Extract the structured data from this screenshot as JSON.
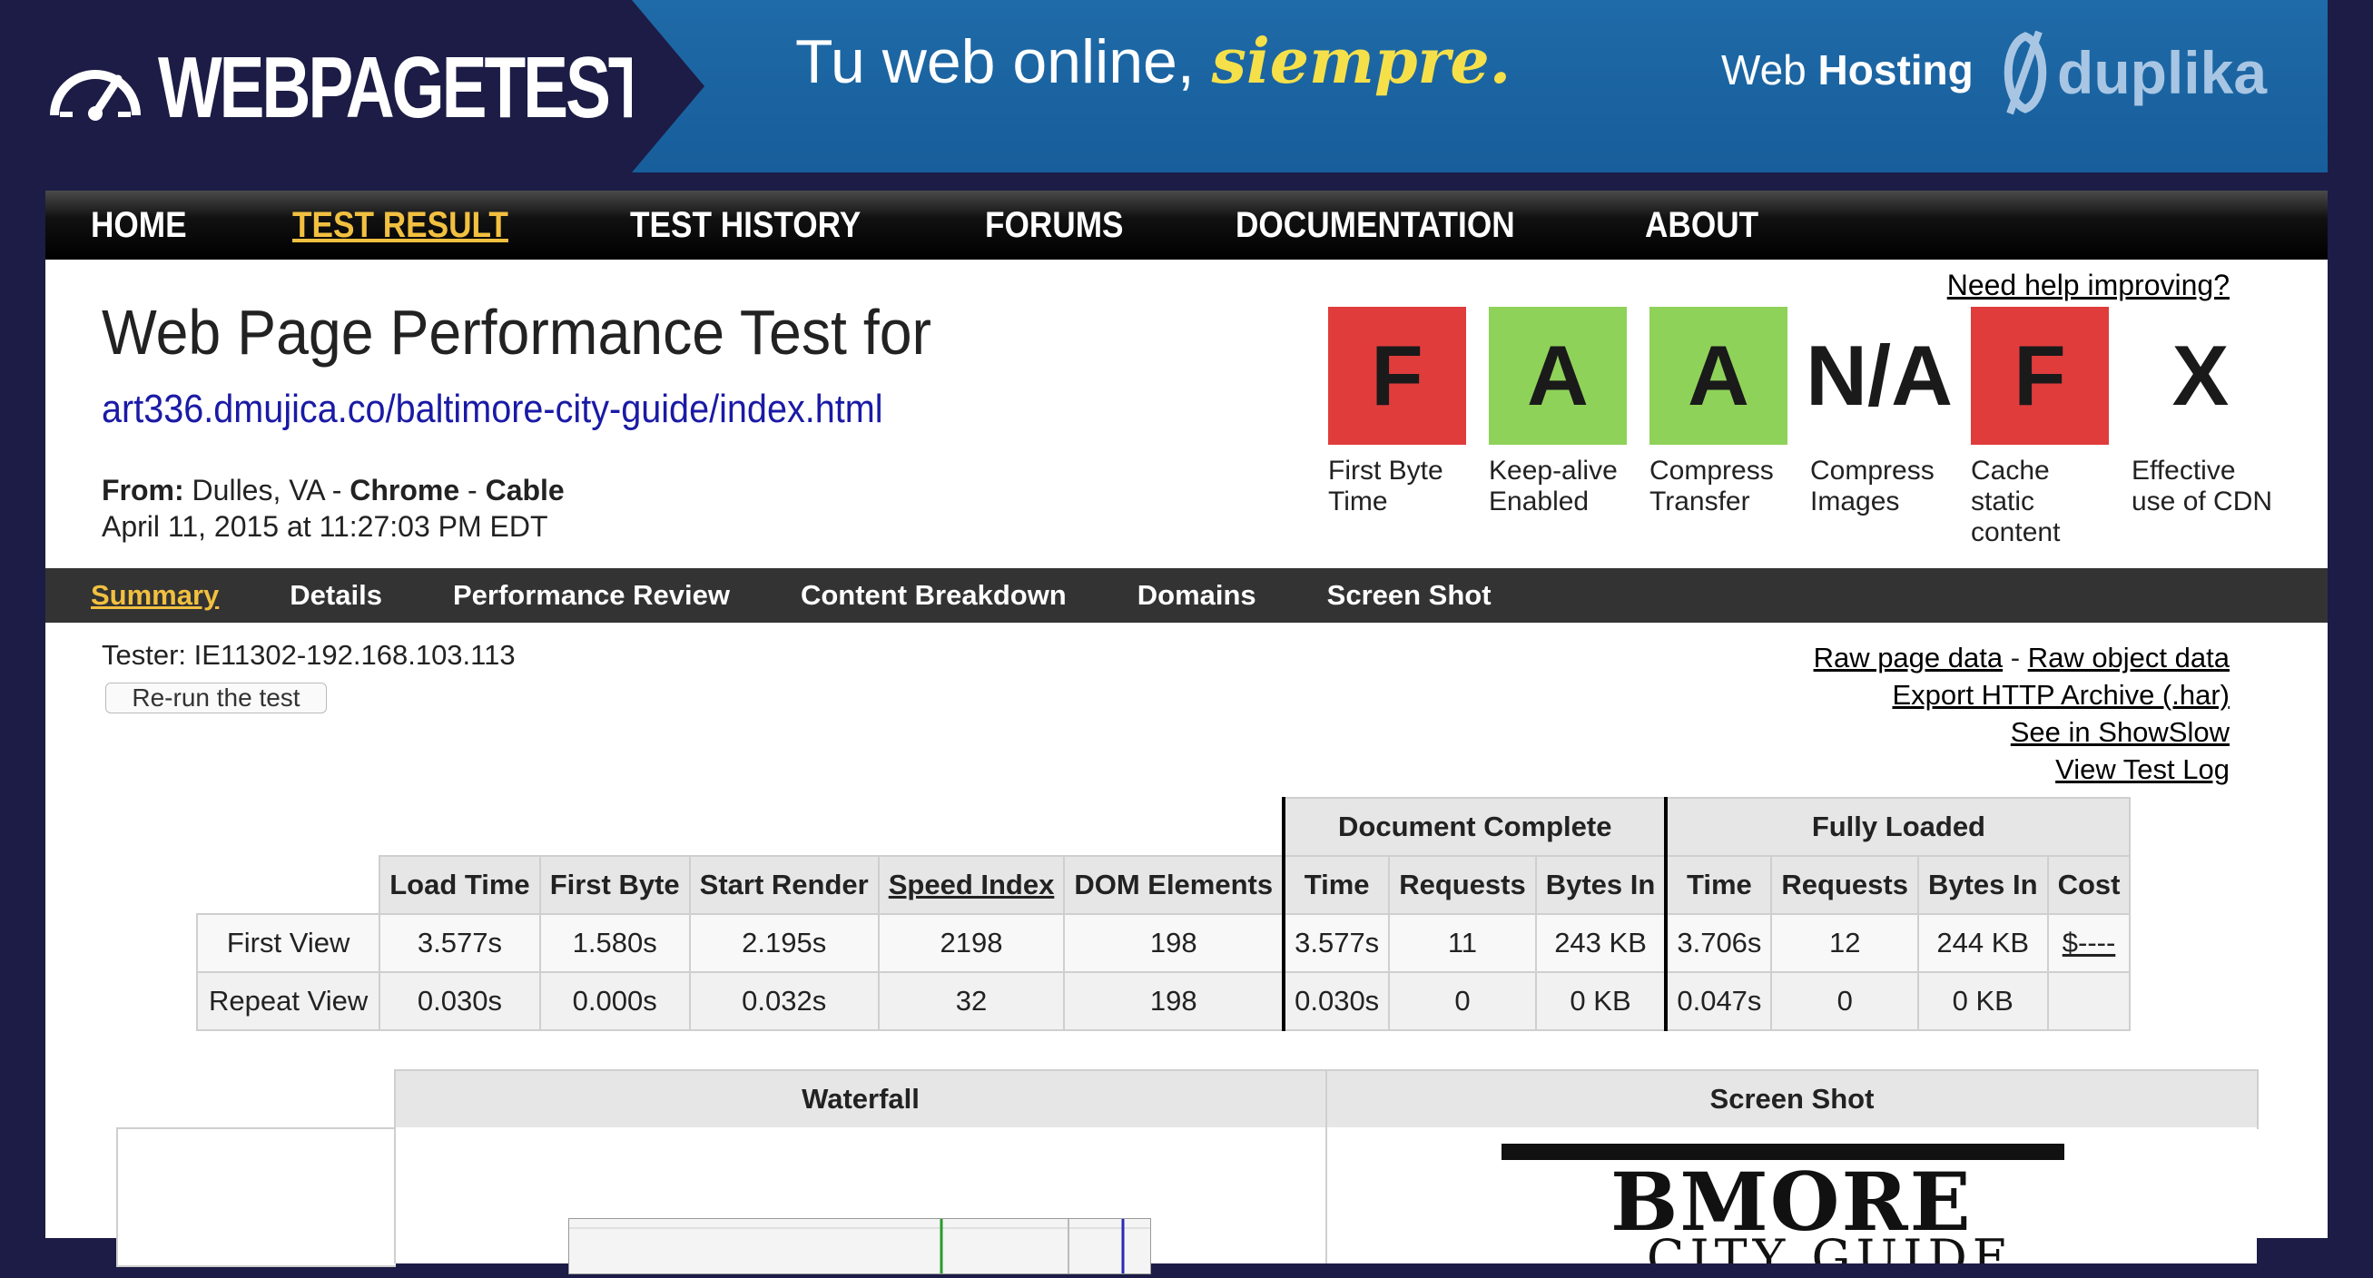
{
  "header": {
    "logo_text": "WEBPAGETEST",
    "banner": {
      "tagline": "Tu web online,",
      "tagline_accent": "siempre.",
      "host_prefix": "Web",
      "host_bold": "Hosting",
      "brand": "duplika"
    }
  },
  "nav": {
    "items": [
      "HOME",
      "TEST RESULT",
      "TEST HISTORY",
      "FORUMS",
      "DOCUMENTATION",
      "ABOUT"
    ],
    "active": "TEST RESULT"
  },
  "page": {
    "title": "Web Page Performance Test for",
    "url": "art336.dmujica.co/baltimore-city-guide/index.html",
    "from_label": "From:",
    "from_location": "Dulles, VA",
    "from_sep": "-",
    "browser": "Chrome",
    "connection": "Cable",
    "date": "April 11, 2015 at 11:27:03 PM EDT",
    "help_link": "Need help improving?"
  },
  "grades": [
    {
      "grade": "F",
      "label": "First Byte Time",
      "color": "#e03c3c"
    },
    {
      "grade": "A",
      "label": "Keep-alive Enabled",
      "color": "#8fd25a"
    },
    {
      "grade": "A",
      "label": "Compress Transfer",
      "color": "#8fd25a"
    },
    {
      "grade": "N/A",
      "label": "Compress Images",
      "color": "#ffffff"
    },
    {
      "grade": "F",
      "label": "Cache static content",
      "color": "#e03c3c"
    },
    {
      "grade": "X",
      "label": "Effective use of CDN",
      "color": "#ffffff"
    }
  ],
  "subnav": {
    "items": [
      "Summary",
      "Details",
      "Performance Review",
      "Content Breakdown",
      "Domains",
      "Screen Shot"
    ],
    "active": "Summary"
  },
  "tester": "Tester: IE11302-192.168.103.113",
  "rerun_label": "Re-run the test",
  "links": {
    "raw_page": "Raw page data",
    "sep": "-",
    "raw_object": "Raw object data",
    "har": "Export HTTP Archive (.har)",
    "showslow": "See in ShowSlow",
    "log": "View Test Log"
  },
  "results": {
    "group_doc": "Document Complete",
    "group_full": "Fully Loaded",
    "headers": [
      "Load Time",
      "First Byte",
      "Start Render",
      "Speed Index",
      "DOM Elements",
      "Time",
      "Requests",
      "Bytes In",
      "Time",
      "Requests",
      "Bytes In",
      "Cost"
    ],
    "rows": [
      {
        "label": "First View",
        "cells": [
          "3.577s",
          "1.580s",
          "2.195s",
          "2198",
          "198",
          "3.577s",
          "11",
          "243 KB",
          "3.706s",
          "12",
          "244 KB",
          "$----"
        ]
      },
      {
        "label": "Repeat View",
        "cells": [
          "0.030s",
          "0.000s",
          "0.032s",
          "32",
          "198",
          "0.030s",
          "0",
          "0 KB",
          "0.047s",
          "0",
          "0 KB",
          ""
        ]
      }
    ]
  },
  "panels": {
    "waterfall": "Waterfall",
    "screenshot": "Screen Shot",
    "thumb_title": "BMORE",
    "thumb_sub": "CITY GUIDE"
  },
  "colors": {
    "page_bg": "#1c1c46",
    "nav_active": "#f2c040",
    "url": "#1a1aa6",
    "grade_fail": "#e03c3c",
    "grade_pass": "#8fd25a"
  }
}
